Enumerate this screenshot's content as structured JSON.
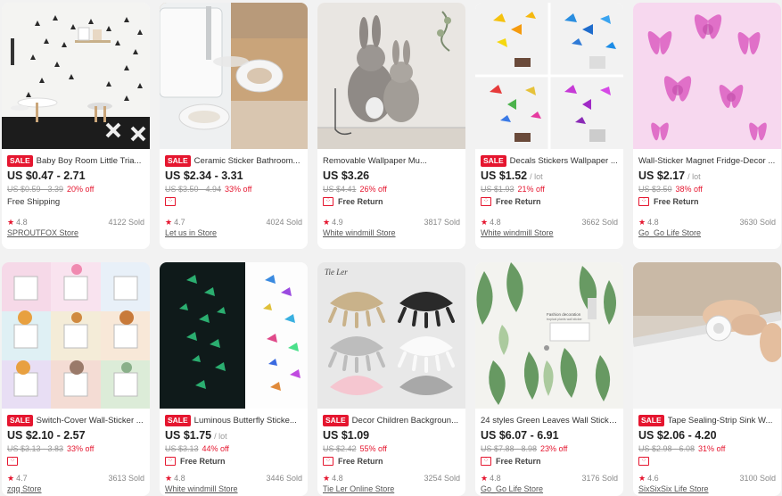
{
  "products": [
    {
      "sale": "SALE",
      "title": "Baby Boy Room Little Tria...",
      "price": "US $0.47 - 2.71",
      "unit": "",
      "orig": "US $0.59 - 3.39",
      "discount": "20% off",
      "shipping": "Free Shipping",
      "free_return": "",
      "rating": "4.8",
      "sold": "4122 Sold",
      "store": "SPROUTFOX Store"
    },
    {
      "sale": "SALE",
      "title": "Ceramic Sticker Bathroom...",
      "price": "US $2.34 - 3.31",
      "unit": "",
      "orig": "US $3.50 - 4.94",
      "discount": "33% off",
      "shipping": "",
      "free_return": "",
      "rating": "4.7",
      "sold": "4024 Sold",
      "store": "Let us in Store"
    },
    {
      "sale": "",
      "title": "Removable Wallpaper Mu...",
      "price": "US $3.26",
      "unit": "",
      "orig": "US $4.41",
      "discount": "26% off",
      "shipping": "",
      "free_return": "Free Return",
      "rating": "4.9",
      "sold": "3817 Sold",
      "store": "White windmill Store"
    },
    {
      "sale": "SALE",
      "title": "Decals Stickers Wallpaper ...",
      "price": "US $1.52",
      "unit": "/ lot",
      "orig": "US $1.93",
      "discount": "21% off",
      "shipping": "",
      "free_return": "Free Return",
      "rating": "4.8",
      "sold": "3662 Sold",
      "store": "White windmill Store"
    },
    {
      "sale": "",
      "title": "Wall-Sticker Magnet Fridge-Decor ...",
      "price": "US $2.17",
      "unit": "/ lot",
      "orig": "US $3.50",
      "discount": "38% off",
      "shipping": "",
      "free_return": "Free Return",
      "rating": "4.8",
      "sold": "3630 Sold",
      "store": "Go_Go Life Store"
    },
    {
      "sale": "SALE",
      "title": "Switch-Cover Wall-Sticker ...",
      "price": "US $2.10 - 2.57",
      "unit": "",
      "orig": "US $3.13 - 3.83",
      "discount": "33% off",
      "shipping": "",
      "free_return": "",
      "rating": "4.7",
      "sold": "3613 Sold",
      "store": "zqq Store"
    },
    {
      "sale": "SALE",
      "title": "Luminous Butterfly Sticke...",
      "price": "US $1.75",
      "unit": "/ lot",
      "orig": "US $3.13",
      "discount": "44% off",
      "shipping": "",
      "free_return": "Free Return",
      "rating": "4.8",
      "sold": "3446 Sold",
      "store": "White windmill Store"
    },
    {
      "sale": "SALE",
      "title": "Decor Children Backgroun...",
      "price": "US $1.09",
      "unit": "",
      "orig": "US $2.42",
      "discount": "55% off",
      "shipping": "",
      "free_return": "Free Return",
      "rating": "4.8",
      "sold": "3254 Sold",
      "store": "Tie Ler Online Store"
    },
    {
      "sale": "",
      "title": "24 styles Green Leaves Wall Sticke...",
      "price": "US $6.07 - 6.91",
      "unit": "",
      "orig": "US $7.88 - 8.98",
      "discount": "23% off",
      "shipping": "",
      "free_return": "Free Return",
      "rating": "4.8",
      "sold": "3176 Sold",
      "store": "Go_Go Life Store"
    },
    {
      "sale": "SALE",
      "title": "Tape Sealing-Strip Sink W...",
      "price": "US $2.06 - 4.20",
      "unit": "",
      "orig": "US $2.98 - 6.08",
      "discount": "31% off",
      "shipping": "",
      "free_return": "",
      "rating": "4.6",
      "sold": "3100 Sold",
      "store": "SixSixSix Life Store"
    }
  ],
  "image_text": {
    "bunny_sign": "Tie Ler",
    "leaves_caption": "Fashion decoration",
    "leaves_sub": "tropical plants wall sticker"
  },
  "colors": {
    "accent": "#e5162f",
    "background": "#f2f2f2",
    "card": "#ffffff"
  }
}
